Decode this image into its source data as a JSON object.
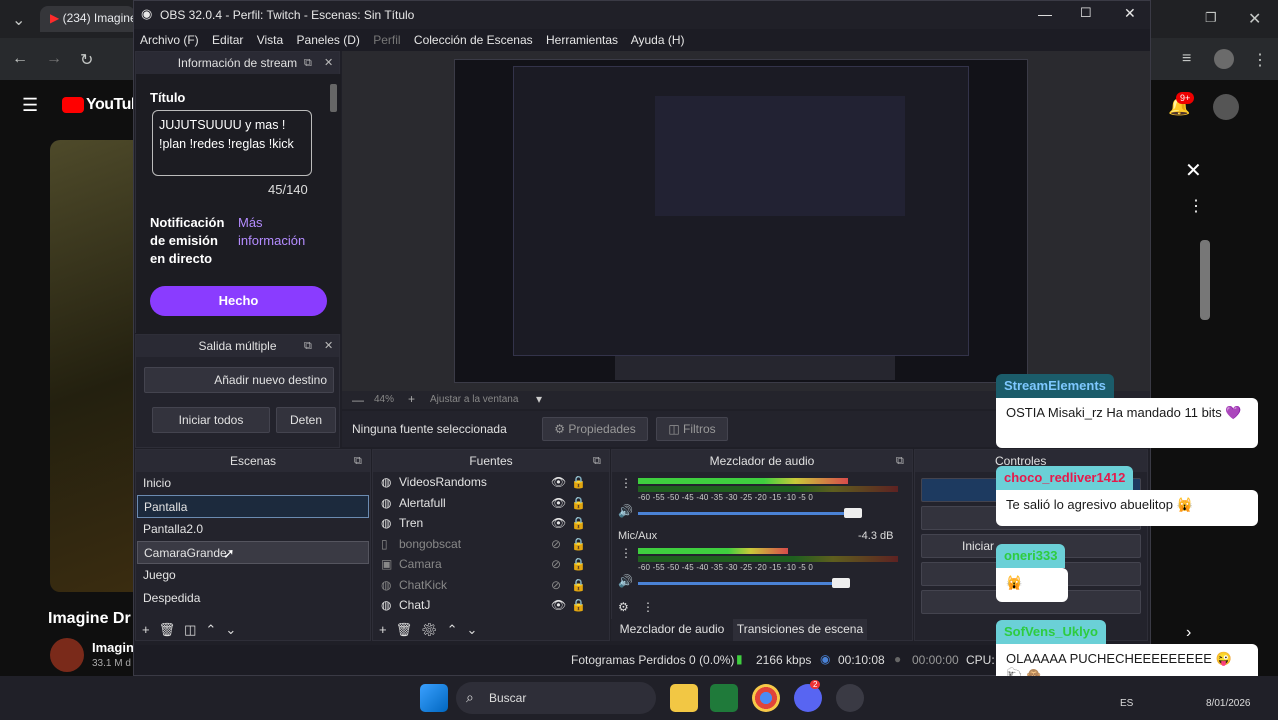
{
  "chrome": {
    "tab_title": "(234) Imagine",
    "colors": {
      "bg": "#202124",
      "tab": "#35363a"
    }
  },
  "youtube": {
    "logo_text": "YouTube",
    "notif_count": "9+",
    "video_title": "Imagine Dr",
    "channel": "Imagin",
    "subs": "33.1 M d"
  },
  "obs": {
    "window_title": "OBS 32.0.4 - Perfil: Twitch - Escenas: Sin Título",
    "menu": [
      "Archivo (F)",
      "Editar",
      "Vista",
      "Paneles (D)",
      "Perfil",
      "Colección de Escenas",
      "Herramientas",
      "Ayuda (H)"
    ],
    "stream_info": {
      "header": "Información de stream",
      "title_label": "Título",
      "title_value": "JUJUTSUUUU y mas ! !plan !redes !reglas !kick",
      "char_count": "45/140",
      "notif_label": "Notificación de emisión en directo",
      "more_info": "Más información",
      "done_button": "Hecho"
    },
    "multi_output": {
      "header": "Salida múltiple",
      "add_dest": "Añadir nuevo destino",
      "start_all": "Iniciar todos",
      "stop": "Deten"
    },
    "preview": {
      "zoom": "44%",
      "fit_label": "Ajustar a la ventana",
      "no_source": "Ninguna fuente seleccionada",
      "properties": "Propiedades",
      "filters": "Filtros"
    },
    "scenes": {
      "header": "Escenas",
      "items": [
        "Inicio",
        "Pantalla",
        "Pantalla2.0",
        "CamaraGrande",
        "Juego",
        "Despedida"
      ]
    },
    "sources": {
      "header": "Fuentes",
      "items": [
        {
          "name": "VideosRandoms",
          "visible": true
        },
        {
          "name": "Alertafull",
          "visible": true
        },
        {
          "name": "Tren",
          "visible": true
        },
        {
          "name": "bongobscat",
          "visible": false
        },
        {
          "name": "Camara",
          "visible": false
        },
        {
          "name": "ChatKick",
          "visible": false
        },
        {
          "name": "ChatJ",
          "visible": true
        }
      ]
    },
    "mixer": {
      "header": "Mezclador de audio",
      "ticks": "-60 -55 -50 -45 -40 -35 -30 -25 -20 -15 -10 -5 0",
      "channel2": "Mic/Aux",
      "channel2_db": "-4.3 dB",
      "tab_mixer": "Mezclador de audio",
      "tab_transitions": "Transiciones de escena"
    },
    "controls": {
      "header": "Controles",
      "btn1": "Det",
      "btn2": "In",
      "btn3": "Iniciar"
    },
    "status": {
      "dropped": "Fotogramas Perdidos 0 (0.0%)",
      "bitrate": "2166 kbps",
      "live_time": "00:10:08",
      "rec_time": "00:00:00",
      "cpu": "CPU:"
    }
  },
  "chat": [
    {
      "user": "StreamElements",
      "color": "#7ec8ff",
      "msg": "OSTIA Misaki_rz Ha mandado 11 bits 💜"
    },
    {
      "user": "choco_redliver1412",
      "color": "#ff4a6e",
      "msg": "Te salió lo agresivo abuelitop 🙀"
    },
    {
      "user": "oneri333",
      "color": "#3bd75a",
      "msg": "🙀"
    },
    {
      "user": "SofVens_Uklyo",
      "color": "#36d66b",
      "msg": "OLAAAAA PUCHECHEEEEEEEEE 😜 🐑 🙈"
    }
  ],
  "taskbar": {
    "search_placeholder": "Buscar",
    "lang": "ES",
    "date": "8/01/2026",
    "discord_badge": "2"
  }
}
